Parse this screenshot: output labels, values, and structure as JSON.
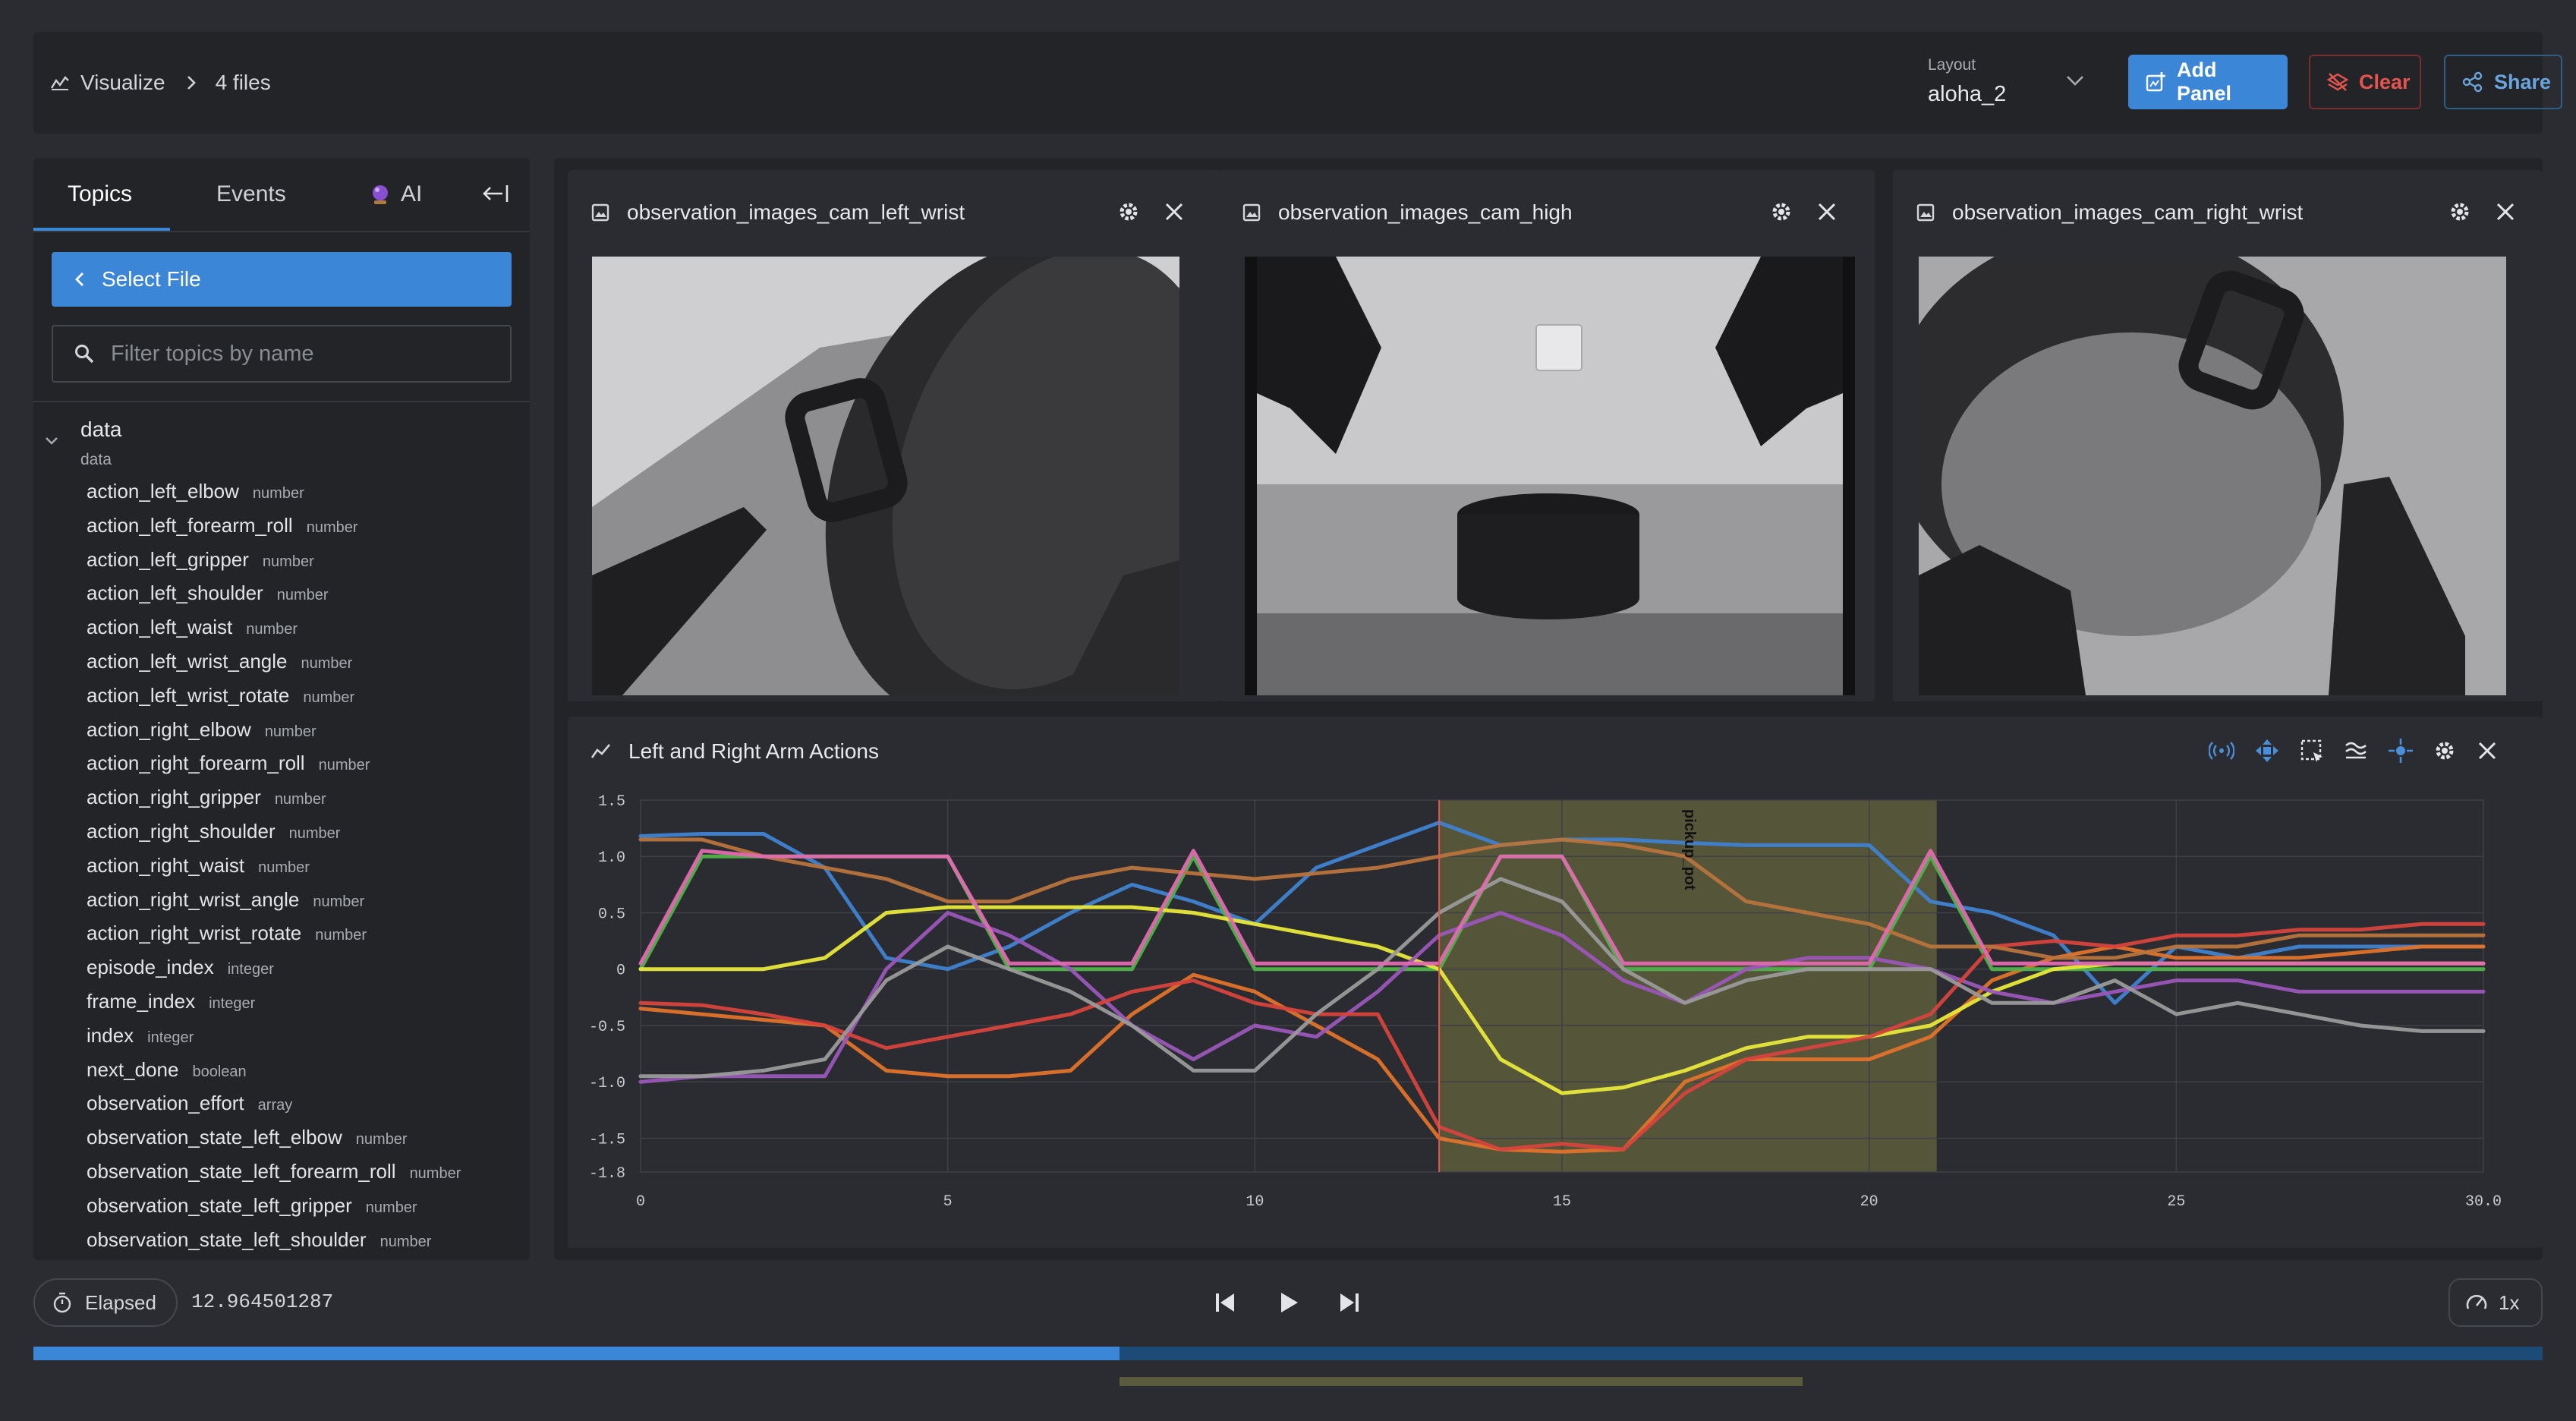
{
  "header": {
    "breadcrumb_root": "Visualize",
    "breadcrumb_current": "4 files",
    "layout_label": "Layout",
    "layout_value": "aloha_2",
    "add_panel": "Add Panel",
    "clear": "Clear",
    "share": "Share"
  },
  "sidebar": {
    "tabs": [
      "Topics",
      "Events",
      "AI"
    ],
    "select_file": "Select File",
    "filter_placeholder": "Filter topics by name",
    "group": {
      "title": "data",
      "subtitle": "data"
    },
    "topics": [
      {
        "name": "action_left_elbow",
        "type": "number"
      },
      {
        "name": "action_left_forearm_roll",
        "type": "number"
      },
      {
        "name": "action_left_gripper",
        "type": "number"
      },
      {
        "name": "action_left_shoulder",
        "type": "number"
      },
      {
        "name": "action_left_waist",
        "type": "number"
      },
      {
        "name": "action_left_wrist_angle",
        "type": "number"
      },
      {
        "name": "action_left_wrist_rotate",
        "type": "number"
      },
      {
        "name": "action_right_elbow",
        "type": "number"
      },
      {
        "name": "action_right_forearm_roll",
        "type": "number"
      },
      {
        "name": "action_right_gripper",
        "type": "number"
      },
      {
        "name": "action_right_shoulder",
        "type": "number"
      },
      {
        "name": "action_right_waist",
        "type": "number"
      },
      {
        "name": "action_right_wrist_angle",
        "type": "number"
      },
      {
        "name": "action_right_wrist_rotate",
        "type": "number"
      },
      {
        "name": "episode_index",
        "type": "integer"
      },
      {
        "name": "frame_index",
        "type": "integer"
      },
      {
        "name": "index",
        "type": "integer"
      },
      {
        "name": "next_done",
        "type": "boolean"
      },
      {
        "name": "observation_effort",
        "type": "array"
      },
      {
        "name": "observation_state_left_elbow",
        "type": "number"
      },
      {
        "name": "observation_state_left_forearm_roll",
        "type": "number"
      },
      {
        "name": "observation_state_left_gripper",
        "type": "number"
      },
      {
        "name": "observation_state_left_shoulder",
        "type": "number"
      }
    ]
  },
  "image_panels": [
    {
      "title": "observation_images_cam_left_wrist"
    },
    {
      "title": "observation_images_cam_high"
    },
    {
      "title": "observation_images_cam_right_wrist"
    }
  ],
  "plot_panel": {
    "title": "Left and Right Arm Actions",
    "event_label": "pickup_pot"
  },
  "chart_data": {
    "type": "line",
    "title": "Left and Right Arm Actions",
    "xlim": [
      0,
      30
    ],
    "ylim": [
      -1.8,
      1.5
    ],
    "x_ticks": [
      "0",
      "5",
      "10",
      "15",
      "20",
      "25",
      "30.0"
    ],
    "y_ticks": [
      "1.5",
      "1.0",
      "0.5",
      "0",
      "-0.5",
      "-1.0",
      "-1.5",
      "-1.8"
    ],
    "grid": true,
    "cursor_time": 13.0,
    "event": {
      "name": "pickup_pot",
      "start": 13.0,
      "end": 21.1
    },
    "x": [
      0,
      1,
      2,
      3,
      4,
      5,
      6,
      7,
      8,
      9,
      10,
      11,
      12,
      13,
      14,
      15,
      16,
      17,
      18,
      19,
      20,
      21,
      22,
      23,
      24,
      25,
      26,
      27,
      28,
      29,
      30
    ],
    "series": [
      {
        "color": "#3f82d0",
        "values": [
          1.18,
          1.2,
          1.2,
          0.9,
          0.1,
          0,
          0.2,
          0.5,
          0.75,
          0.6,
          0.4,
          0.9,
          1.1,
          1.3,
          1.1,
          1.15,
          1.15,
          1.12,
          1.1,
          1.1,
          1.1,
          0.6,
          0.5,
          0.3,
          -0.3,
          0.2,
          0.1,
          0.2,
          0.2,
          0.2,
          0.2
        ]
      },
      {
        "color": "#e0722a",
        "values": [
          -0.35,
          -0.4,
          -0.45,
          -0.5,
          -0.9,
          -0.95,
          -0.95,
          -0.9,
          -0.4,
          -0.05,
          -0.2,
          -0.5,
          -0.8,
          -1.5,
          -1.6,
          -1.62,
          -1.6,
          -1.0,
          -0.8,
          -0.8,
          -0.8,
          -0.6,
          -0.1,
          0.1,
          0.2,
          0.1,
          0.1,
          0.1,
          0.15,
          0.2,
          0.2
        ]
      },
      {
        "color": "#4fb24a",
        "values": [
          0,
          1.0,
          1.0,
          1.0,
          1.0,
          1.0,
          0,
          0,
          0,
          1.0,
          0,
          0,
          0,
          0,
          1.0,
          1.0,
          0,
          0,
          0,
          0,
          0,
          1.0,
          0,
          0,
          0,
          0,
          0,
          0,
          0,
          0,
          0
        ]
      },
      {
        "color": "#e8e83a",
        "values": [
          0,
          0,
          0,
          0.1,
          0.5,
          0.55,
          0.55,
          0.55,
          0.55,
          0.5,
          0.4,
          0.3,
          0.2,
          0,
          -0.8,
          -1.1,
          -1.05,
          -0.9,
          -0.7,
          -0.6,
          -0.6,
          -0.5,
          -0.2,
          0,
          0.05,
          0.05,
          0.05,
          0.05,
          0.05,
          0.05,
          0.05
        ]
      },
      {
        "color": "#9a56b8",
        "values": [
          -1.0,
          -0.95,
          -0.95,
          -0.95,
          0,
          0.5,
          0.3,
          0,
          -0.5,
          -0.8,
          -0.5,
          -0.6,
          -0.2,
          0.3,
          0.5,
          0.3,
          -0.1,
          -0.3,
          0,
          0.1,
          0.1,
          0,
          -0.2,
          -0.3,
          -0.2,
          -0.1,
          -0.1,
          -0.2,
          -0.2,
          -0.2,
          -0.2
        ]
      },
      {
        "color": "#d6433c",
        "values": [
          -0.3,
          -0.32,
          -0.4,
          -0.5,
          -0.7,
          -0.6,
          -0.5,
          -0.4,
          -0.2,
          -0.1,
          -0.3,
          -0.4,
          -0.4,
          -1.4,
          -1.6,
          -1.55,
          -1.6,
          -1.1,
          -0.8,
          -0.7,
          -0.6,
          -0.4,
          0.2,
          0.25,
          0.2,
          0.3,
          0.3,
          0.35,
          0.35,
          0.4,
          0.4
        ]
      },
      {
        "color": "#9a9a9a",
        "values": [
          -0.95,
          -0.95,
          -0.9,
          -0.8,
          -0.1,
          0.2,
          0,
          -0.2,
          -0.5,
          -0.9,
          -0.9,
          -0.4,
          0,
          0.5,
          0.8,
          0.6,
          0,
          -0.3,
          -0.1,
          0,
          0,
          0,
          -0.3,
          -0.3,
          -0.1,
          -0.4,
          -0.3,
          -0.4,
          -0.5,
          -0.55,
          -0.55
        ]
      },
      {
        "color": "#b8743c",
        "values": [
          1.15,
          1.15,
          1.0,
          0.9,
          0.8,
          0.6,
          0.6,
          0.8,
          0.9,
          0.85,
          0.8,
          0.85,
          0.9,
          1.0,
          1.1,
          1.15,
          1.1,
          1.0,
          0.6,
          0.5,
          0.4,
          0.2,
          0.2,
          0.1,
          0.1,
          0.2,
          0.2,
          0.3,
          0.3,
          0.3,
          0.3
        ]
      },
      {
        "color": "#e06ab0",
        "values": [
          0.05,
          1.05,
          1.0,
          1.0,
          1.0,
          1.0,
          0.05,
          0.05,
          0.05,
          1.05,
          0.05,
          0.05,
          0.05,
          0.05,
          1.0,
          1.0,
          0.05,
          0.05,
          0.05,
          0.05,
          0.05,
          1.05,
          0.05,
          0.05,
          0.05,
          0.05,
          0.05,
          0.05,
          0.05,
          0.05,
          0.05
        ]
      }
    ]
  },
  "playback": {
    "elapsed_label": "Elapsed",
    "elapsed_value": "12.964501287",
    "speed": "1x",
    "progress": 0.433,
    "range_start": 0.433,
    "range_end": 0.705
  }
}
